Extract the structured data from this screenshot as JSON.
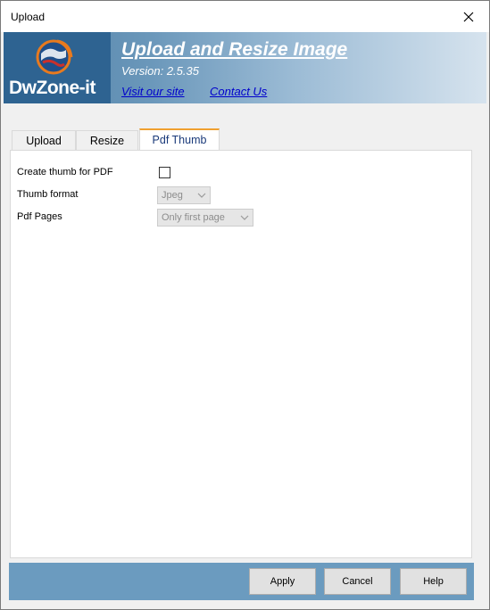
{
  "window": {
    "title": "Upload"
  },
  "banner": {
    "logo_text": "DwZone-it",
    "app_title": "Upload and Resize Image",
    "version": "Version: 2.5.35",
    "visit_link": "Visit our site",
    "contact_link": "Contact Us"
  },
  "tabs": [
    {
      "label": "Upload",
      "active": false
    },
    {
      "label": "Resize",
      "active": false
    },
    {
      "label": "Pdf Thumb",
      "active": true
    }
  ],
  "pdf_thumb": {
    "create_thumb_label": "Create thumb for PDF",
    "create_thumb_checked": false,
    "thumb_format_label": "Thumb format",
    "thumb_format_value": "Jpeg",
    "pdf_pages_label": "Pdf Pages",
    "pdf_pages_value": "Only first page"
  },
  "footer": {
    "apply_label": "Apply",
    "cancel_label": "Cancel",
    "help_label": "Help"
  },
  "colors": {
    "banner_dark": "#2e6391",
    "footer_bar": "#6b9bbf",
    "active_tab_accent": "#f0a030",
    "link": "#0000cc"
  },
  "icons": {
    "close": "close-icon",
    "logo": "globe-icon",
    "dropdown": "chevron-down-icon"
  }
}
